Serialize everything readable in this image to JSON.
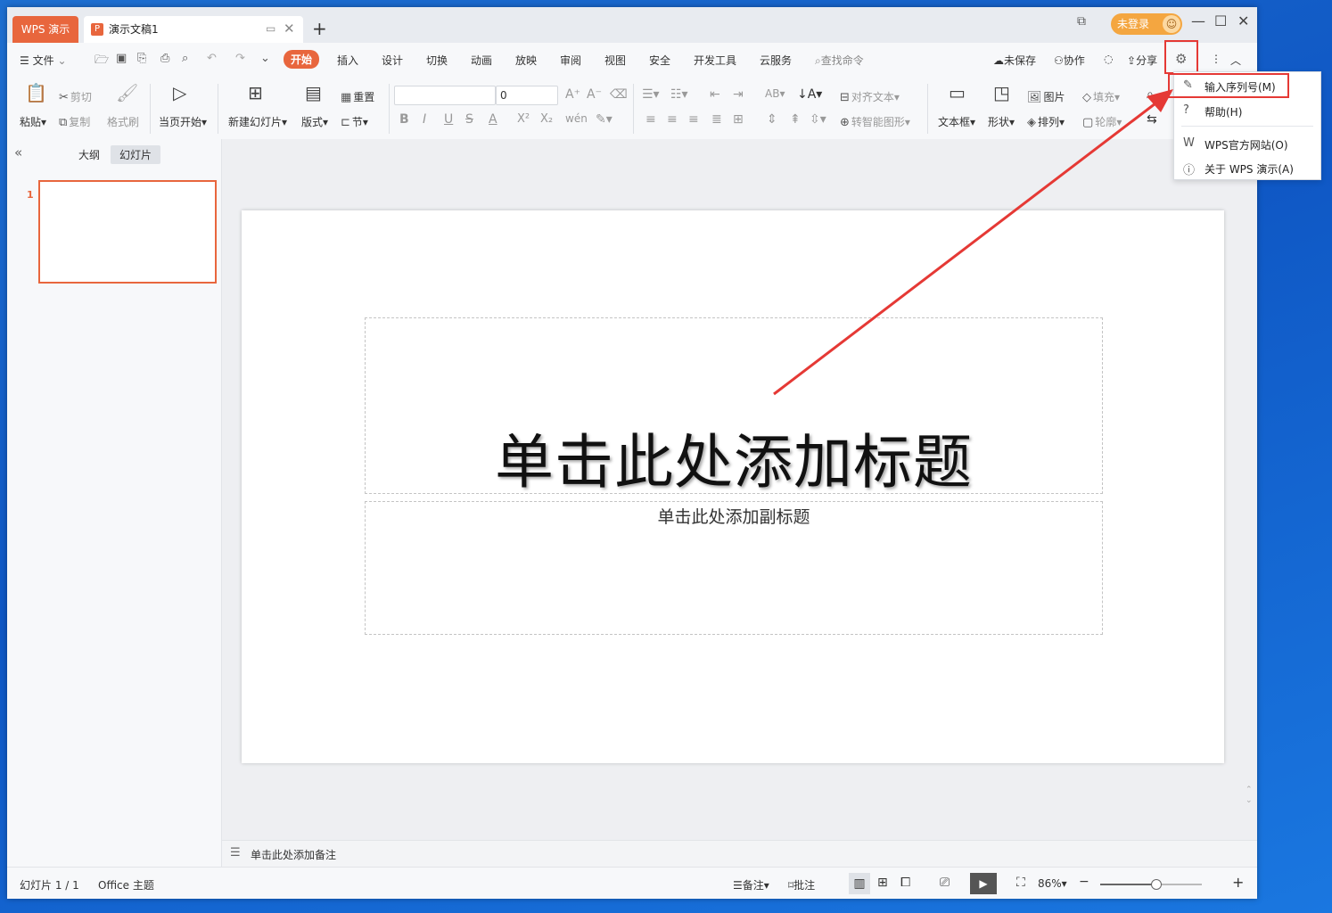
{
  "titlebar": {
    "app_tab": "WPS 演示",
    "doc_icon": "P",
    "doc_tab": "演示文稿1",
    "login_label": "未登录"
  },
  "menubar": {
    "file": "文件",
    "tabs": [
      "开始",
      "插入",
      "设计",
      "切换",
      "动画",
      "放映",
      "审阅",
      "视图",
      "安全",
      "开发工具",
      "云服务"
    ],
    "search": "查找命令",
    "unsaved": "未保存",
    "collab": "协作",
    "share": "分享"
  },
  "ribbon": {
    "paste": "粘贴",
    "cut": "剪切",
    "copy": "复制",
    "format_painter": "格式刷",
    "start_from_current": "当页开始",
    "new_slide": "新建幻灯片",
    "layout": "版式",
    "reset": "重置",
    "section": "节",
    "font_size": "0",
    "align_text": "对齐文本",
    "convert_smartart": "转智能图形",
    "textbox": "文本框",
    "shape": "形状",
    "picture": "图片",
    "arrange": "排列",
    "fill": "填充",
    "outline": "轮廓",
    "bold": "B",
    "italic": "I",
    "underline": "U",
    "strike": "S",
    "font_color": "A",
    "superscript": "X²",
    "subscript": "X₂",
    "phonetic": "wén"
  },
  "left_panel": {
    "tab_outline": "大纲",
    "tab_slides": "幻灯片",
    "slide_number": "1"
  },
  "slide": {
    "title_placeholder": "单击此处添加标题",
    "subtitle_placeholder": "单击此处添加副标题"
  },
  "notes": {
    "placeholder": "单击此处添加备注"
  },
  "status": {
    "slide_count": "幻灯片 1 / 1",
    "theme": "Office 主题",
    "notes": "备注",
    "comments": "批注",
    "zoom": "86%",
    "zoom_level": 0.55
  },
  "dropdown": {
    "items": [
      "输入序列号(M)",
      "帮助(H)",
      "WPS官方网站(O)",
      "关于 WPS 演示(A)"
    ]
  },
  "colors": {
    "accent": "#e8663d",
    "highlight": "#e53935"
  }
}
